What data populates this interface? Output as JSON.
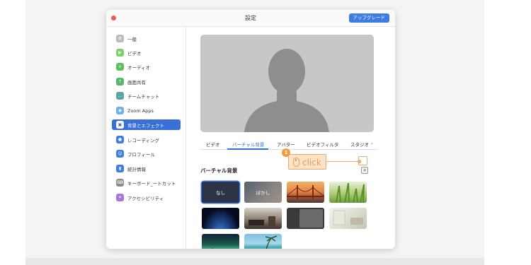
{
  "window": {
    "title": "設定",
    "upgrade_label": "アップグレード"
  },
  "sidebar": {
    "items": [
      {
        "label": "一般",
        "icon": "gear-icon",
        "color": "#bdbdbd",
        "active": false
      },
      {
        "label": "ビデオ",
        "icon": "video-icon",
        "color": "#7fcf6a",
        "active": false
      },
      {
        "label": "オーディオ",
        "icon": "headphones-icon",
        "color": "#5cbf5c",
        "active": false
      },
      {
        "label": "画面共有",
        "icon": "share-screen-icon",
        "color": "#58b66a",
        "active": false
      },
      {
        "label": "チームチャット",
        "icon": "chat-icon",
        "color": "#5aa6a0",
        "active": false
      },
      {
        "label": "Zoom Apps",
        "icon": "apps-icon",
        "color": "#6db3e8",
        "active": false
      },
      {
        "label": "背景とエフェクト",
        "icon": "background-icon",
        "color": "#ffffff",
        "active": true
      },
      {
        "label": "レコーディング",
        "icon": "record-icon",
        "color": "#3e7de2",
        "active": false
      },
      {
        "label": "プロフィール",
        "icon": "profile-icon",
        "color": "#3e7de2",
        "active": false
      },
      {
        "label": "統計情報",
        "icon": "stats-icon",
        "color": "#3e7de2",
        "active": false
      },
      {
        "label": "キーボード_ートカット",
        "icon": "keyboard-icon",
        "color": "#8b8b8b",
        "active": false
      },
      {
        "label": "アクセシビリティ",
        "icon": "accessibility-icon",
        "color": "#a679d8",
        "active": false
      }
    ]
  },
  "tabs": [
    {
      "label": "ビデオ",
      "active": false
    },
    {
      "label": "バーチャル背景",
      "active": true
    },
    {
      "label": "アバター",
      "active": false
    },
    {
      "label": "ビデオフィルタ",
      "active": false
    },
    {
      "label": "スタジオ",
      "active": false
    }
  ],
  "section": {
    "title": "バーチャル背景",
    "add_icon": "plus-icon"
  },
  "backgrounds": [
    {
      "label": "なし",
      "scene": "none",
      "selected": true
    },
    {
      "label": "ぼかし",
      "scene": "blur",
      "selected": false
    },
    {
      "label": "",
      "scene": "golden-gate-bridge",
      "selected": false
    },
    {
      "label": "",
      "scene": "grass",
      "selected": false
    },
    {
      "label": "",
      "scene": "earth-from-space",
      "selected": false
    },
    {
      "label": "",
      "scene": "living-room",
      "selected": false
    },
    {
      "label": "",
      "scene": "video-dark",
      "selected": false
    },
    {
      "label": "",
      "scene": "bright-room",
      "selected": false
    },
    {
      "label": "",
      "scene": "aurora",
      "selected": false
    },
    {
      "label": "",
      "scene": "beach",
      "selected": false
    }
  ],
  "callout": {
    "step": "1",
    "text": "click"
  },
  "colors": {
    "accent": "#3a6fd6",
    "callout": "#ef9a4c"
  }
}
